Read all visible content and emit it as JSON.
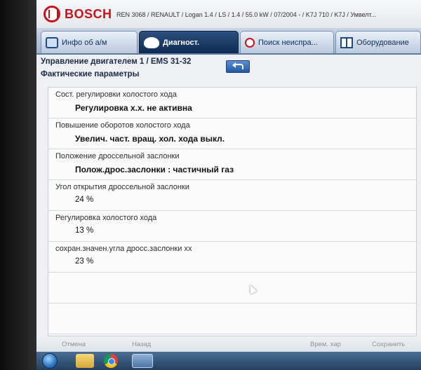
{
  "header": {
    "brand": "BOSCH",
    "vehicle": "REN 3068 / RENAULT / Logan 1.4 / LS / 1.4 / 55.0 kW / 07/2004 - / K7J 710 / K7J / Умвелт..."
  },
  "tabs": [
    {
      "label": "Инфо об а/м",
      "icon": "car-icon"
    },
    {
      "label": "Диагност.",
      "icon": "diagnosis-icon",
      "active": true
    },
    {
      "label": "Поиск неиспра...",
      "icon": "search-icon"
    },
    {
      "label": "Оборудование",
      "icon": "book-icon"
    }
  ],
  "page": {
    "title": "Управление двигателем 1 / EMS 31-32",
    "subtitle": "Фактические параметры"
  },
  "parameters": [
    {
      "label": "Сост. регулировки холостого хода",
      "value": "Регулировка х.х. не активна"
    },
    {
      "label": "Повышение оборотов холостого хода",
      "value": "Увелич. част. вращ. хол. хода выкл."
    },
    {
      "label": "Положение дроссельной заслонки",
      "value": "Полож.дрос.заслонки : частичный газ"
    },
    {
      "label": "Угол открытия дроссельной заслонки",
      "value": "24 %"
    },
    {
      "label": "Регулировка холостого хода",
      "value": "13 %"
    },
    {
      "label": "сохран.значен.угла дросс.заслонки хх",
      "value": "23 %"
    }
  ],
  "bottom_bar": {
    "cancel": "Отмена",
    "back": "Назад",
    "record": "Врем. хар",
    "save": "Сохранить"
  },
  "colors": {
    "brand_red": "#c4141b",
    "active_tab": "#0f2b52",
    "tab_bar": "#9fb3cc"
  }
}
